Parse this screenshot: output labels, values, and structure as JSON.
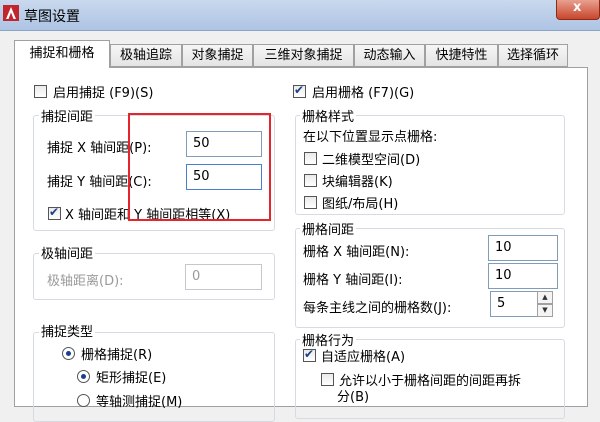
{
  "window": {
    "title": "草图设置",
    "close_label": "x"
  },
  "tabs": [
    {
      "label": "捕捉和栅格",
      "active": true
    },
    {
      "label": "极轴追踪"
    },
    {
      "label": "对象捕捉"
    },
    {
      "label": "三维对象捕捉"
    },
    {
      "label": "动态输入"
    },
    {
      "label": "快捷特性"
    },
    {
      "label": "选择循环"
    }
  ],
  "snap": {
    "enable_label": "启用捕捉 (F9)(S)",
    "enable_checked": false,
    "spacing": {
      "title": "捕捉间距",
      "x_label": "捕捉 X 轴间距(P):",
      "x_value": "50",
      "y_label": "捕捉 Y 轴间距(C):",
      "y_value": "50",
      "equal_label": "X 轴间距和 Y 轴间距相等(X)",
      "equal_checked": true
    },
    "polar": {
      "title": "极轴间距",
      "distance_label": "极轴距离(D):",
      "distance_value": "0"
    },
    "type": {
      "title": "捕捉类型",
      "grid_snap_label": "栅格捕捉(R)",
      "rect_snap_label": "矩形捕捉(E)",
      "iso_snap_label": "等轴测捕捉(M)"
    }
  },
  "grid": {
    "enable_label": "启用栅格 (F7)(G)",
    "enable_checked": true,
    "style": {
      "title": "栅格样式",
      "subtitle": "在以下位置显示点栅格:",
      "options": [
        {
          "label": "二维模型空间(D)",
          "checked": false
        },
        {
          "label": "块编辑器(K)",
          "checked": false
        },
        {
          "label": "图纸/布局(H)",
          "checked": false
        }
      ]
    },
    "spacing": {
      "title": "栅格间距",
      "x_label": "栅格 X 轴间距(N):",
      "x_value": "10",
      "y_label": "栅格 Y 轴间距(I):",
      "y_value": "10",
      "major_label": "每条主线之间的栅格数(J):",
      "major_value": "5"
    },
    "behavior": {
      "title": "栅格行为",
      "adaptive_label": "自适应栅格(A)",
      "adaptive_checked": true,
      "subdiv_label_1": "允许以小于栅格间距的间距再拆",
      "subdiv_label_2": "分(B)"
    }
  },
  "colors": {
    "highlight_box": "#e5242b",
    "accent": "#1b3f8c"
  }
}
